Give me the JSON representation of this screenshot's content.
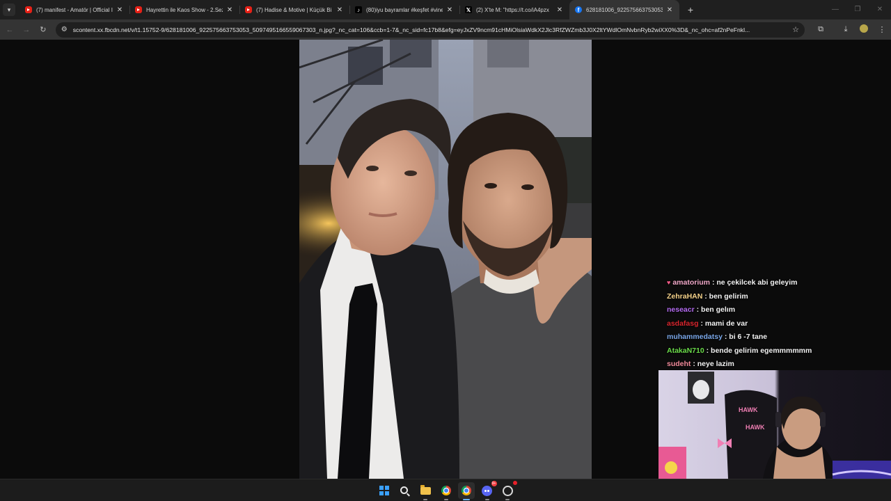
{
  "browser": {
    "tabs": [
      {
        "icon": "youtube-icon",
        "title": "(7) manifest - Amatör | Official I",
        "active": false
      },
      {
        "icon": "youtube-icon",
        "title": "Hayrettin ile Kaos Show - 2.Sez",
        "active": false
      },
      {
        "icon": "youtube-icon",
        "title": "(7) Hadise & Motive | Küçük Bi",
        "active": false
      },
      {
        "icon": "tiktok-icon",
        "title": "(80)iyu bayramlar #keşfet #vine",
        "active": false
      },
      {
        "icon": "x-icon",
        "title": "(2) X'te M: \"https://t.co/iA4pzx",
        "active": false
      },
      {
        "icon": "facebook-icon",
        "title": "628181006_922575663753053",
        "active": true
      }
    ],
    "url": "scontent.xx.fbcdn.net/v/t1.15752-9/628181006_922575663753053_5097495166559067303_n.jpg?_nc_cat=106&ccb=1-7&_nc_sid=fc17b8&efg=eyJxZV9ncm91cHMiOlsiaWdkX2Jlc3RfZWZmb3J0X2ltYWdlOmNvbnRyb2wiXX0%3D&_nc_ohc=af2nPeFnkl..."
  },
  "chat": {
    "messages": [
      {
        "user": "amatorium",
        "text": ": ne çekilcek abi geleyim",
        "color": "#f0a8c8",
        "badge": true
      },
      {
        "user": "ZehraHAN",
        "text": ": ben gelirim",
        "color": "#f5d28a",
        "badge": false
      },
      {
        "user": "neseacr",
        "text": ": ben gelım",
        "color": "#b36bf0",
        "badge": false
      },
      {
        "user": "asdafasg",
        "text": ": mami de var",
        "color": "#d8262e",
        "badge": false
      },
      {
        "user": "muhammedatsy",
        "text": ": bi 6 -7 tane",
        "color": "#7aa7e8",
        "badge": false
      },
      {
        "user": "AtakaN710",
        "text": ": bende gelirim egemmmmmm",
        "color": "#6bdc4a",
        "badge": false
      },
      {
        "user": "sudeht",
        "text": ": neye lazim",
        "color": "#f08a9a",
        "badge": false
      }
    ]
  },
  "webcam": {
    "chair_brand": "HAWK",
    "chair_brand_2": "HAWK"
  },
  "taskbar": {
    "discord_badge": "9+"
  }
}
